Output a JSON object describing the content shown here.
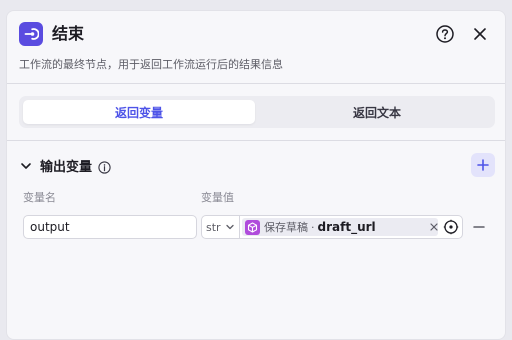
{
  "header": {
    "title": "结束",
    "description": "工作流的最终节点，用于返回工作流运行后的结果信息",
    "icon": "end-node-icon",
    "accent_color": "#5a4ce0"
  },
  "tabs": [
    {
      "label": "返回变量",
      "active": true
    },
    {
      "label": "返回文本",
      "active": false
    }
  ],
  "output_section": {
    "title": "输出变量",
    "columns": {
      "name": "变量名",
      "value": "变量值"
    },
    "rows": [
      {
        "name": "output",
        "type": "str",
        "ref_node": "保存草稿",
        "ref_separator": "·",
        "ref_var": "draft_url"
      }
    ]
  },
  "colors": {
    "primary": "#4d53e8",
    "tag_icon": "#b04cdc"
  }
}
